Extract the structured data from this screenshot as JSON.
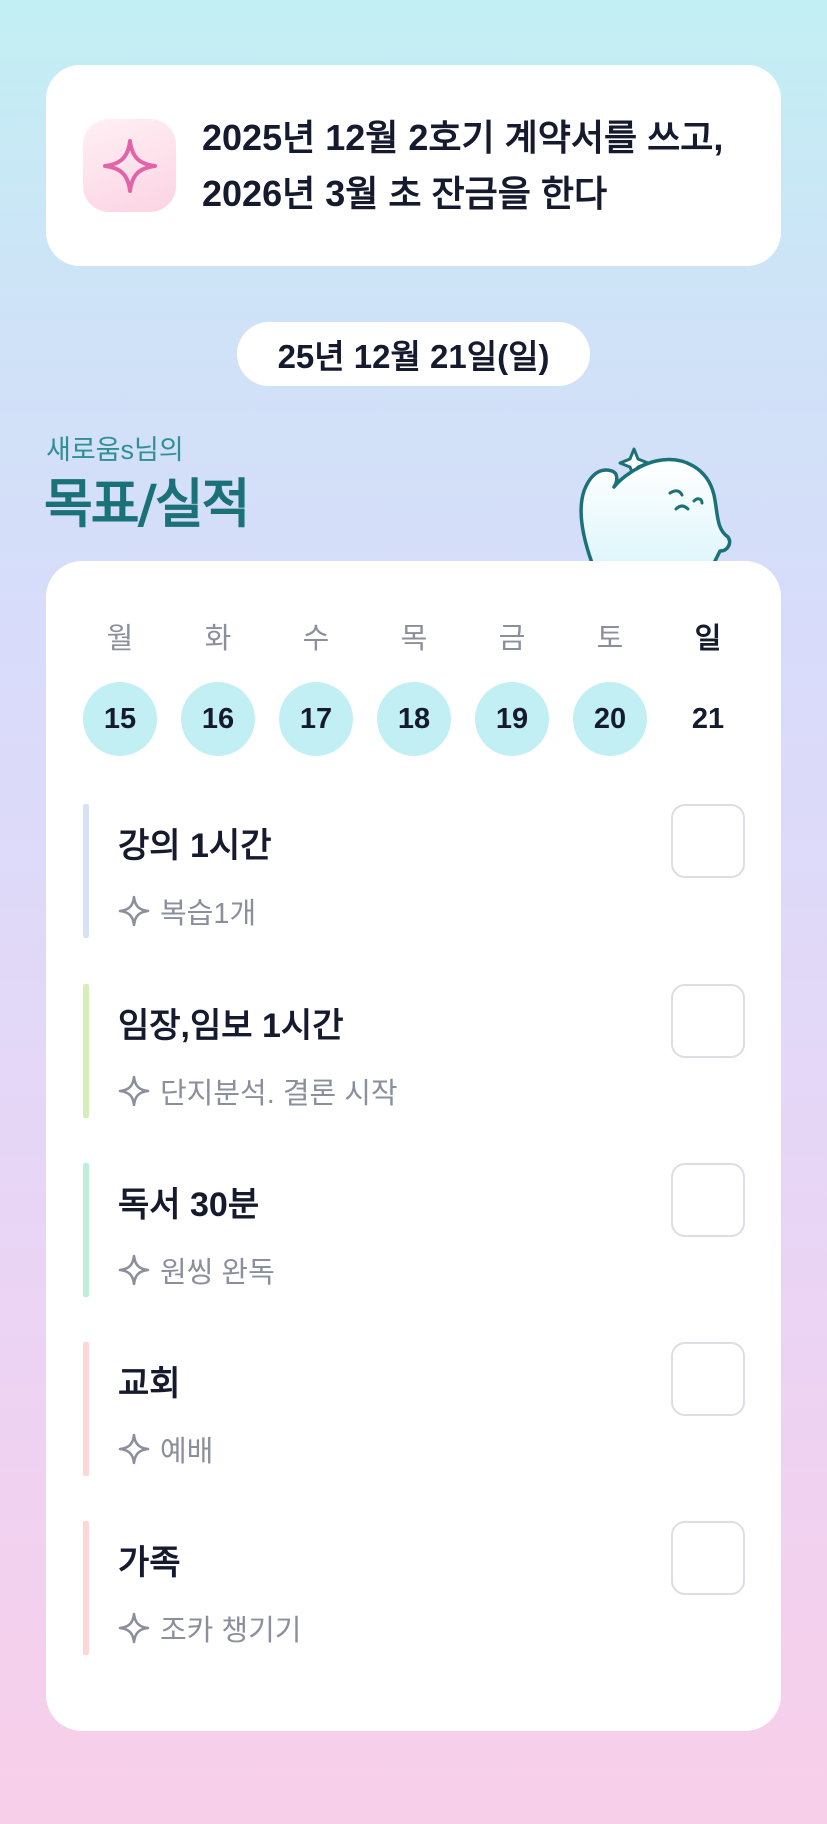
{
  "goal": {
    "line1": "2025년 12월 2호기 계약서를 쓰고,",
    "line2": "2026년 3월 초 잔금을 한다",
    "icon": "sparkle-icon"
  },
  "date_label": "25년 12월 21일(일)",
  "owner_label": "새로움s님의",
  "section_title": "목표/실적",
  "week": [
    {
      "name": "월",
      "date": "15",
      "done": true
    },
    {
      "name": "화",
      "date": "16",
      "done": true
    },
    {
      "name": "수",
      "date": "17",
      "done": true
    },
    {
      "name": "목",
      "date": "18",
      "done": true
    },
    {
      "name": "금",
      "date": "19",
      "done": true
    },
    {
      "name": "토",
      "date": "20",
      "done": true
    },
    {
      "name": "일",
      "date": "21",
      "done": false,
      "current": true
    }
  ],
  "tasks": [
    {
      "title": "강의 1시간",
      "sub": "복습1개",
      "color": "#d8e1f5",
      "checked": false
    },
    {
      "title": "임장,임보 1시간",
      "sub": "단지분석. 결론 시작",
      "color": "#d6efb8",
      "checked": false
    },
    {
      "title": "독서 30분",
      "sub": "원씽 완독",
      "color": "#bdf0dc",
      "checked": false
    },
    {
      "title": "교회",
      "sub": "예배",
      "color": "#fbd8d6",
      "checked": false
    },
    {
      "title": "가족",
      "sub": "조카 챙기기",
      "color": "#fbd8d6",
      "checked": false
    }
  ],
  "colors": {
    "accent_teal": "#1b7178",
    "day_done": "#c2eff4",
    "sparkle_pink": "#e264a8"
  }
}
